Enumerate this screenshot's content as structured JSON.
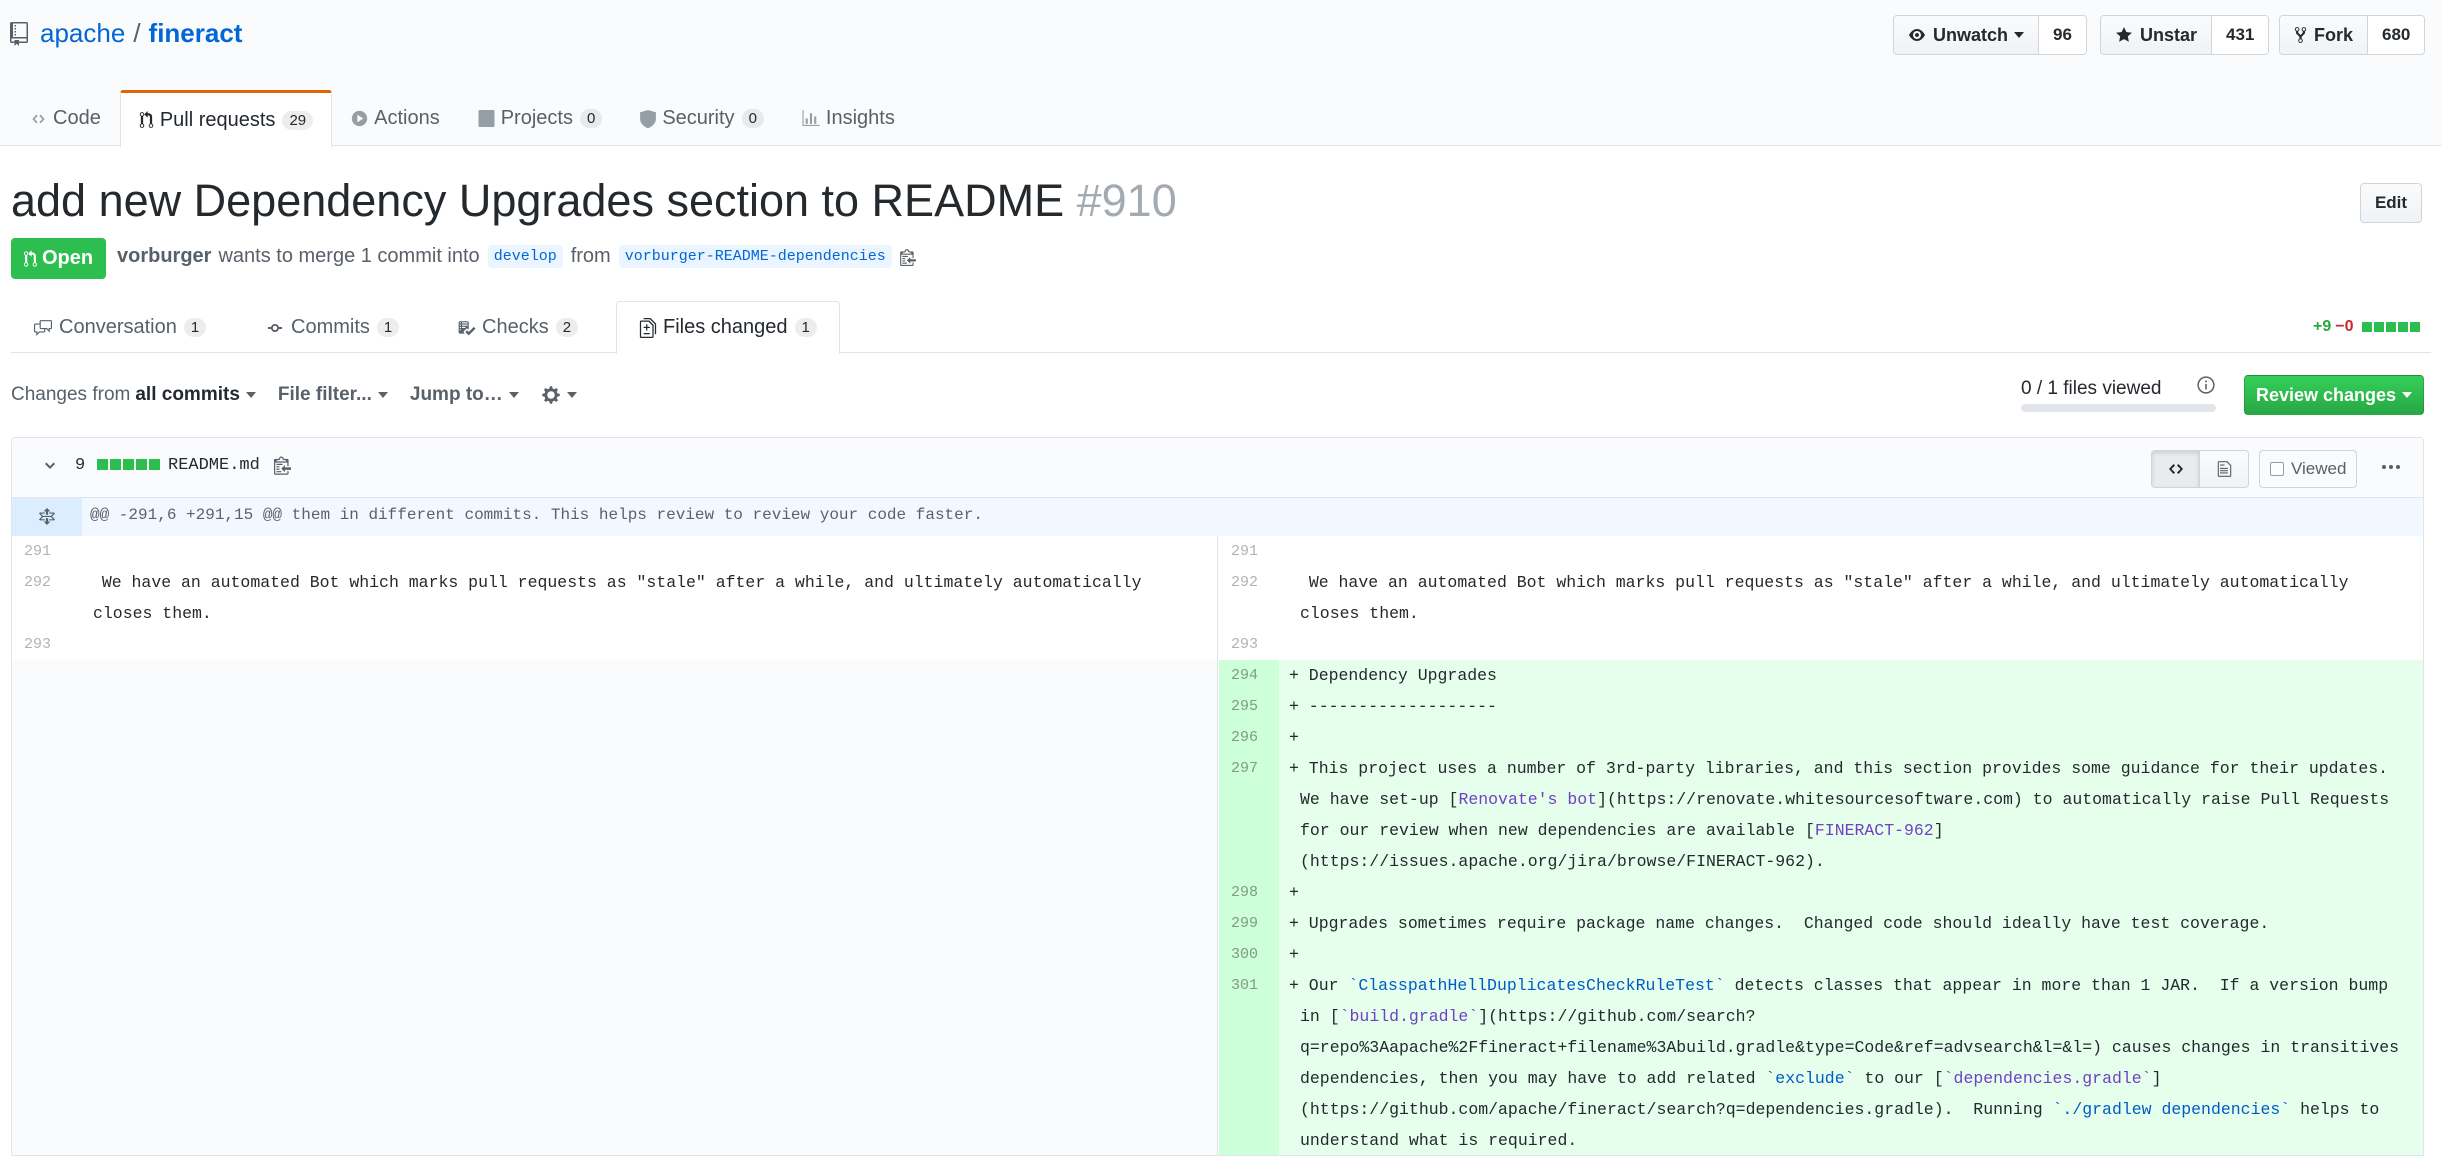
{
  "repo": {
    "owner": "apache",
    "separator": "/",
    "name": "fineract"
  },
  "actions": {
    "watch": {
      "label": "Unwatch",
      "count": "96"
    },
    "star": {
      "label": "Unstar",
      "count": "431"
    },
    "fork": {
      "label": "Fork",
      "count": "680"
    }
  },
  "nav": {
    "code": "Code",
    "pulls": {
      "label": "Pull requests",
      "count": "29"
    },
    "actions": "Actions",
    "projects": {
      "label": "Projects",
      "count": "0"
    },
    "security": {
      "label": "Security",
      "count": "0"
    },
    "insights": "Insights"
  },
  "pr": {
    "title": "add new Dependency Upgrades section to README",
    "number": "#910",
    "edit_label": "Edit",
    "state": "Open",
    "author": "vorburger",
    "meta_text": "wants to merge 1 commit into",
    "base_branch": "develop",
    "from_text": "from",
    "head_branch": "vorburger-README-dependencies"
  },
  "tabs": {
    "conversation": {
      "label": "Conversation",
      "count": "1"
    },
    "commits": {
      "label": "Commits",
      "count": "1"
    },
    "checks": {
      "label": "Checks",
      "count": "2"
    },
    "files": {
      "label": "Files changed",
      "count": "1"
    }
  },
  "diffstat": {
    "additions": "+9",
    "deletions": "−0"
  },
  "toolbar": {
    "changes_from": "Changes from",
    "all_commits": "all commits",
    "file_filter": "File filter...",
    "jump_to": "Jump to…",
    "files_viewed": "0 / 1 files viewed",
    "files_viewed_fraction": 0,
    "review_label": "Review changes"
  },
  "file": {
    "changes": "9",
    "name": "README.md",
    "viewed_label": "Viewed",
    "hunk": "@@ -291,6 +291,15 @@ them in different commits. This helps review to review your code faster.",
    "left": [
      {
        "ln": "291",
        "text": " "
      },
      {
        "ln": "292",
        "text": "  We have an automated Bot which marks pull requests as \"stale\" after a while, and ultimately automatically closes them."
      },
      {
        "ln": "293",
        "text": " "
      }
    ],
    "right": [
      {
        "ln": "291",
        "text": " "
      },
      {
        "ln": "292",
        "text": "  We have an automated Bot which marks pull requests as \"stale\" after a while, and ultimately automatically closes them."
      },
      {
        "ln": "293",
        "text": " "
      },
      {
        "ln": "294",
        "text": "+ Dependency Upgrades"
      },
      {
        "ln": "295",
        "text": "+ -------------------"
      },
      {
        "ln": "296",
        "text": "+"
      },
      {
        "ln": "297",
        "pre": "+ This project uses a number of 3rd-party libraries, and this section provides some guidance for their updates. We have set-up [",
        "link1": "Renovate's bot",
        "mid": "](https://renovate.whitesourcesoftware.com) to automatically raise Pull Requests for our review when new dependencies are available [",
        "link2": "FINERACT-962",
        "post": "](https://issues.apache.org/jira/browse/FINERACT-962)."
      },
      {
        "ln": "298",
        "text": "+"
      },
      {
        "ln": "299",
        "text": "+ Upgrades sometimes require package name changes.  Changed code should ideally have test coverage."
      },
      {
        "ln": "300",
        "text": "+"
      },
      {
        "ln": "301",
        "p1": "+ Our ",
        "c1": "`ClasspathHellDuplicatesCheckRuleTest`",
        "p2": " detects classes that appear in more than 1 JAR.  If a version bump in [",
        "c2": "`build.gradle`",
        "p3": "](https://github.com/search?q=repo%3Aapache%2Ffineract+filename%3Abuild.gradle&type=Code&ref=advsearch&l=&l=) causes changes in transitives dependencies, then you may have to add related ",
        "c3": "`exclude`",
        "p4": " to our [",
        "c4": "`dependencies.gradle`",
        "p5": "](https://github.com/apache/fineract/search?q=dependencies.gradle).  Running ",
        "c5": "`./gradlew dependencies`",
        "p6": " helps to understand what is required."
      }
    ]
  },
  "colors": {
    "link": "#0366d6",
    "open_green": "#2cbe4e",
    "addition_bg": "#e6ffed",
    "addition_gutter": "#cdffd8",
    "nav_accent": "#e36209"
  }
}
